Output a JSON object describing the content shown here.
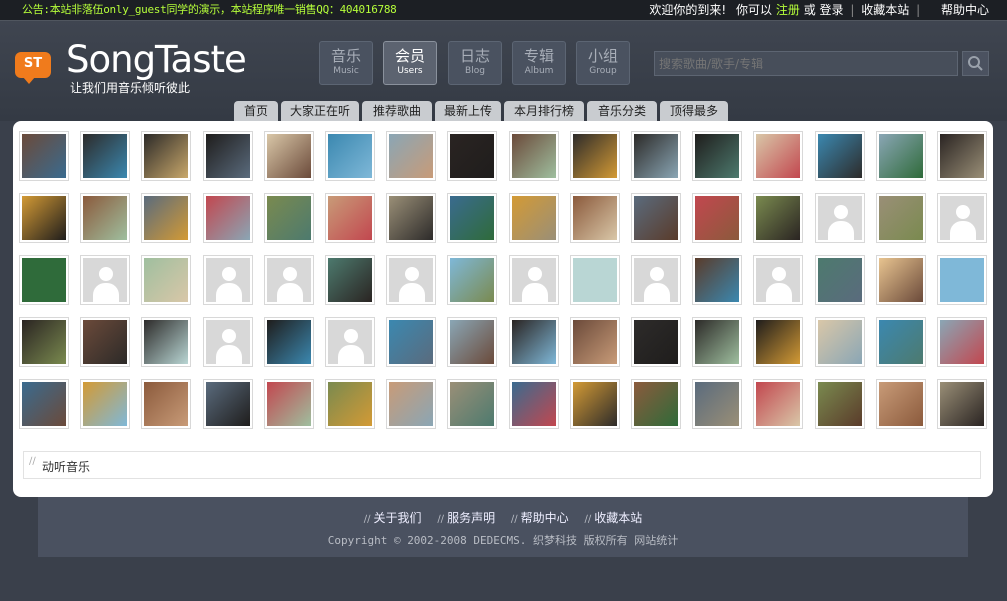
{
  "topbar": {
    "notice": "公告:本站非落伍only_guest同学的演示，本站程序唯一销售QQ：404016788",
    "welcome": "欢迎你的到来!",
    "prompt": "你可以",
    "register": "注册",
    "or": "或",
    "login": "登录",
    "bookmark": "收藏本站",
    "help": "帮助中心"
  },
  "header": {
    "logo_badge": "ST",
    "logo_text": "SongTaste",
    "slogan": "让我们用音乐倾听彼此",
    "nav": [
      {
        "cn": "音乐",
        "en": "Music"
      },
      {
        "cn": "会员",
        "en": "Users"
      },
      {
        "cn": "日志",
        "en": "Blog"
      },
      {
        "cn": "专辑",
        "en": "Album"
      },
      {
        "cn": "小组",
        "en": "Group"
      }
    ],
    "search_placeholder": "搜索歌曲/歌手/专辑"
  },
  "subtabs": [
    "首页",
    "大家正在听",
    "推荐歌曲",
    "最新上传",
    "本月排行榜",
    "音乐分类",
    "顶得最多"
  ],
  "avatars": [
    [
      "photo",
      "photo",
      "photo",
      "photo",
      "photo",
      "photo",
      "photo",
      "photo",
      "photo",
      "photo",
      "photo",
      "photo",
      "photo",
      "photo",
      "photo",
      "photo"
    ],
    [
      "photo",
      "photo",
      "photo",
      "photo",
      "photo",
      "photo",
      "photo",
      "photo",
      "photo",
      "photo",
      "photo",
      "photo",
      "photo",
      "default",
      "photo",
      "default"
    ],
    [
      "photo",
      "default",
      "photo",
      "default",
      "default",
      "photo",
      "default",
      "photo",
      "default",
      "photo",
      "default",
      "photo",
      "default",
      "photo",
      "photo",
      "photo"
    ],
    [
      "photo",
      "photo",
      "photo",
      "default",
      "photo",
      "default",
      "photo",
      "photo",
      "photo",
      "photo",
      "photo",
      "photo",
      "photo",
      "photo",
      "photo",
      "photo"
    ],
    [
      "photo",
      "photo",
      "photo",
      "photo",
      "photo",
      "photo",
      "photo",
      "photo",
      "photo",
      "photo",
      "photo",
      "photo",
      "photo",
      "photo",
      "photo",
      "photo"
    ]
  ],
  "tag_text": "动听音乐",
  "footer": {
    "links": [
      "关于我们",
      "服务声明",
      "帮助中心",
      "收藏本站"
    ],
    "copyright": "Copyright © 2002-2008 DEDECMS. 织梦科技 版权所有 网站统计"
  },
  "colors": {
    "accent_green": "#b6ff3a",
    "logo_orange": "#f07b1c",
    "panel_bg": "#ffffff",
    "page_bg": "#3a404b"
  }
}
